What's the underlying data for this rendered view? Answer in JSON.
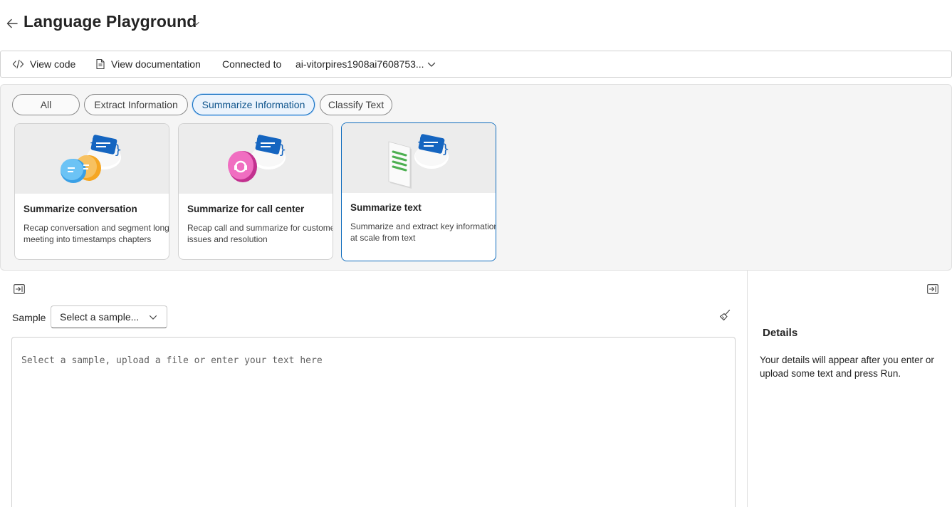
{
  "header": {
    "title": "Language Playground"
  },
  "toolbar": {
    "view_code": "View code",
    "view_documentation": "View documentation",
    "connected_label": "Connected to",
    "resource_name": "ai-vitorpires1908ai7608753..."
  },
  "filters": {
    "items": [
      {
        "label": "All",
        "selected": false
      },
      {
        "label": "Extract Information",
        "selected": false
      },
      {
        "label": "Summarize Information",
        "selected": true
      },
      {
        "label": "Classify Text",
        "selected": false
      }
    ]
  },
  "cards": [
    {
      "title": "Summarize conversation",
      "description": "Recap conversation and segment long meeting into timestamps chapters",
      "icon": "chat-bubbles-summary-icon",
      "selected": false
    },
    {
      "title": "Summarize for call center",
      "description": "Recap call and summarize for customer issues and resolution",
      "icon": "headset-bubble-summary-icon",
      "selected": false
    },
    {
      "title": "Summarize text",
      "description": "Summarize and extract key information at scale from text",
      "icon": "document-summary-icon",
      "selected": true
    }
  ],
  "input_pane": {
    "sample_label": "Sample",
    "sample_select_value": "Select a sample...",
    "textarea_placeholder": "Select a sample, upload a file or enter your text here"
  },
  "details_pane": {
    "title": "Details",
    "text": "Your details will appear after you enter or upload some text and press Run."
  },
  "colors": {
    "accent": "#0f6cbd",
    "selected_pill_bg": "#ebf3fc",
    "gallery_bg": "#f5f5f5"
  }
}
